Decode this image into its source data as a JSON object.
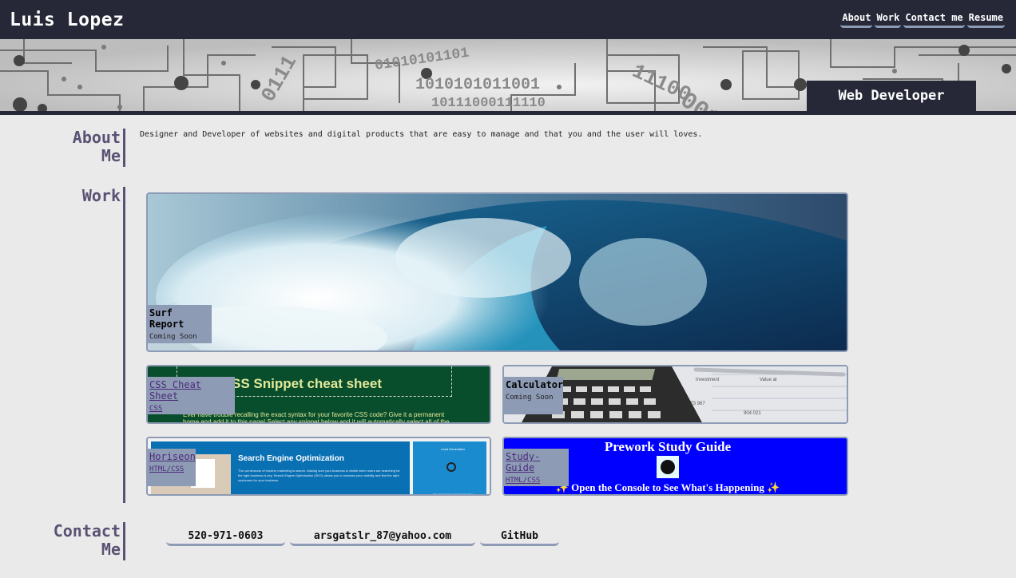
{
  "header": {
    "site_title": "Luis Lopez",
    "nav": [
      "About",
      "Work",
      "Contact me",
      "Resume"
    ]
  },
  "hero": {
    "badge": "Web Developer",
    "binary_text": "011101010110101100101011011001011100"
  },
  "about": {
    "heading_line1": "About",
    "heading_line2": "Me",
    "text": "Designer and Developer of websites and digital products that are easy to manage and that you and the user will loves."
  },
  "work": {
    "heading": "Work",
    "projects": [
      {
        "title": "Surf Report",
        "subtitle": "Coming Soon"
      },
      {
        "title": "CSS Cheat Sheet",
        "subtitle": "CSS",
        "thumb_title": "SS Snippet cheat sheet",
        "thumb_text": "Ever have trouble recalling the exact syntax for your favorite CSS code? Give it a permanent home and add it to this page! Select any snippet below and it will automatically select all of the"
      },
      {
        "title": "Calculator",
        "subtitle": "Coming Soon"
      },
      {
        "title": "Horiseon",
        "subtitle": "HTML/CSS",
        "thumb_title": "Search Engine Optimization",
        "thumb_text": "The cornerstone of modern marketing is search. Making sure your business is visible when users are searching for the right business is key. Search Engine Optimization (SEO) allows you to increase your visibility and find the right customers for your business.",
        "thumb_side_title": "Lead Generation",
        "thumb_side_text": "Inbound strategies for lead generation"
      },
      {
        "title": "Study-Guide",
        "subtitle": "HTML/CSS",
        "thumb_title": "Prework Study Guide",
        "thumb_text": "✨ Open the Console to See What's Happening ✨"
      }
    ]
  },
  "contact": {
    "heading_line1": "Contact",
    "heading_line2": "Me",
    "phone": "520-971-0603",
    "email": "arsgatslr_87@yahoo.com",
    "github": "GitHub"
  },
  "colors": {
    "dark": "#262838",
    "accent": "#8d9bb5",
    "heading": "#5a5274",
    "background": "#ebeaea"
  }
}
